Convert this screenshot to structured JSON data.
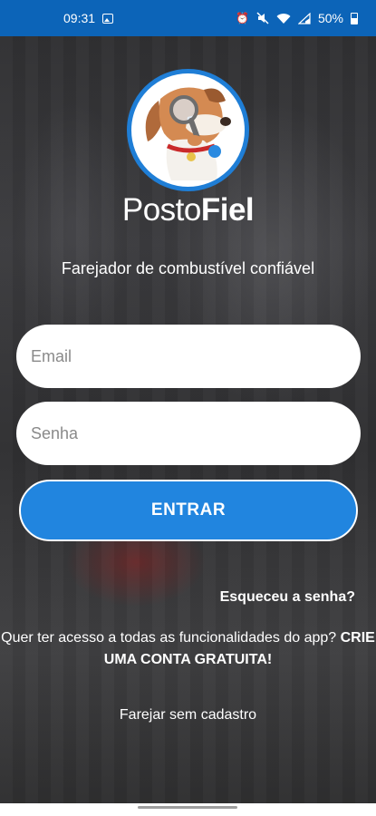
{
  "status_bar": {
    "time": "09:31",
    "battery": "50%",
    "icons": [
      "image-icon",
      "alarm-icon",
      "mute-icon",
      "wifi-icon",
      "signal-icon",
      "battery-icon"
    ]
  },
  "brand": {
    "part1": "Posto",
    "part2": "Fiel"
  },
  "tagline": "Farejador de combustível confiável",
  "form": {
    "email_placeholder": "Email",
    "password_placeholder": "Senha",
    "login_label": "ENTRAR"
  },
  "forgot_label": "Esqueceu a senha?",
  "signup": {
    "text": "Quer ter acesso a todas as funcionalidades do app?",
    "cta": "CRIE UMA CONTA GRATUITA!"
  },
  "guest_label": "Farejar sem cadastro",
  "colors": {
    "status_bar": "#0c64b8",
    "primary": "#2185df",
    "logo_ring": "#1f7ed6"
  }
}
